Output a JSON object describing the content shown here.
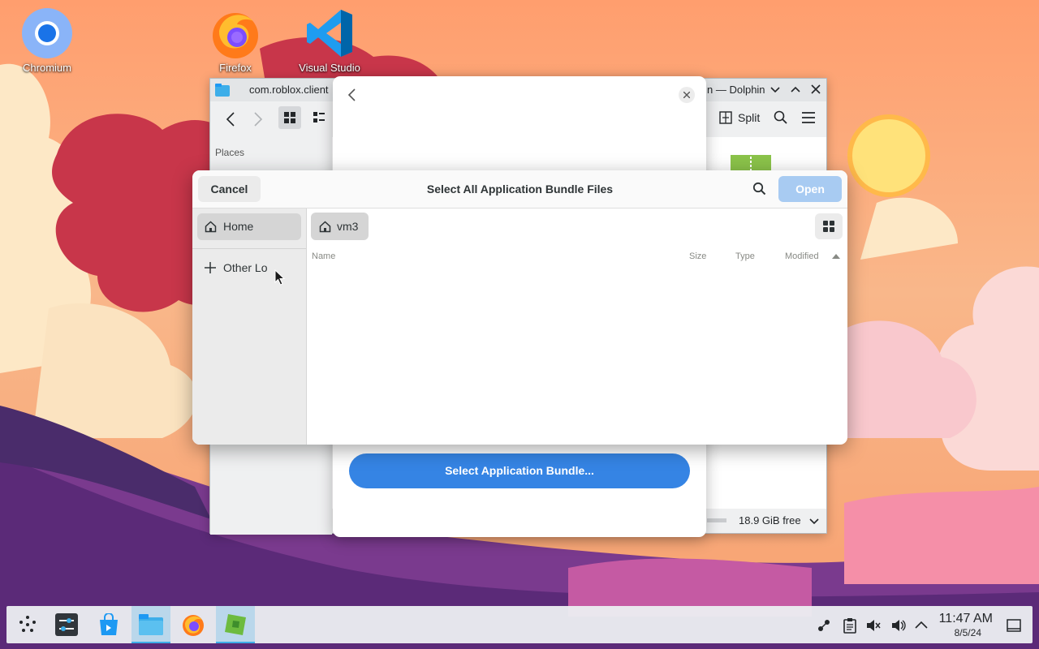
{
  "desktop": {
    "icons": [
      {
        "label": "Chromium",
        "icon": "chromium-icon"
      },
      {
        "label": "Firefox",
        "icon": "firefox-icon"
      },
      {
        "label": "Visual Studio",
        "icon": "vscode-icon"
      }
    ]
  },
  "dolphin": {
    "title_left": "com.roblox.client",
    "title_right": "n — Dolphin",
    "places_heading": "Places",
    "split_label": "Split",
    "free_space": "18.9 GiB free"
  },
  "bundle_dialog": {
    "select_button": "Select Application Bundle..."
  },
  "file_chooser": {
    "title": "Select All Application Bundle Files",
    "cancel": "Cancel",
    "open": "Open",
    "sidebar": [
      {
        "label": "Home",
        "icon": "home-icon",
        "selected": true
      },
      {
        "label": "Other Lo",
        "icon": "plus-icon",
        "selected": false
      }
    ],
    "path_button": "vm3",
    "columns": {
      "name": "Name",
      "size": "Size",
      "type": "Type",
      "modified": "Modified"
    }
  },
  "taskbar": {
    "time": "11:47 AM",
    "date": "8/5/24"
  },
  "colors": {
    "accent": "#3584e4",
    "open_disabled": "#a8cbf2",
    "kde_accent": "#3daee9"
  }
}
